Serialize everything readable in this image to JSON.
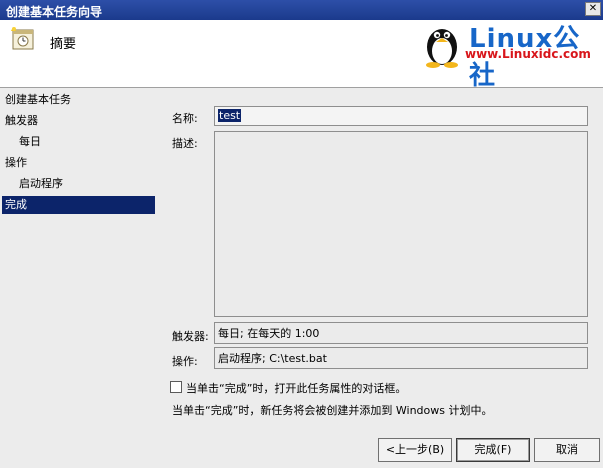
{
  "window": {
    "title": "创建基本任务向导",
    "close_symbol": "✕"
  },
  "header": {
    "title": "摘要",
    "icon": "task-calendar-icon"
  },
  "watermark": {
    "title": "Linux公社",
    "subtitle": "www.Linuxidc.com"
  },
  "nav": {
    "items": [
      {
        "label": "创建基本任务",
        "selected": false
      },
      {
        "label": "触发器",
        "selected": false
      },
      {
        "label": "每日",
        "selected": false
      },
      {
        "label": "操作",
        "selected": false
      },
      {
        "label": "启动程序",
        "selected": false
      },
      {
        "label": "完成",
        "selected": true
      }
    ]
  },
  "form": {
    "name_label": "名称:",
    "name_value": "test",
    "description_label": "描述:",
    "description_value": "",
    "trigger_label": "触发器:",
    "trigger_value": "每日; 在每天的 1:00",
    "action_label": "操作:",
    "action_value": "启动程序; C:\\test.bat"
  },
  "options": {
    "checkbox_label": "当单击“完成”时，打开此任务属性的对话框。",
    "checkbox_checked": false,
    "info_text": "当单击“完成”时，新任务将会被创建并添加到 Windows 计划中。"
  },
  "buttons": {
    "back": "<上一步(B)",
    "finish": "完成(F)",
    "cancel": "取消"
  },
  "colors": {
    "selection": "#0c246a",
    "titlebar": "#1b3a8c",
    "watermark_blue": "#1766c8",
    "watermark_red": "#d8161b"
  }
}
